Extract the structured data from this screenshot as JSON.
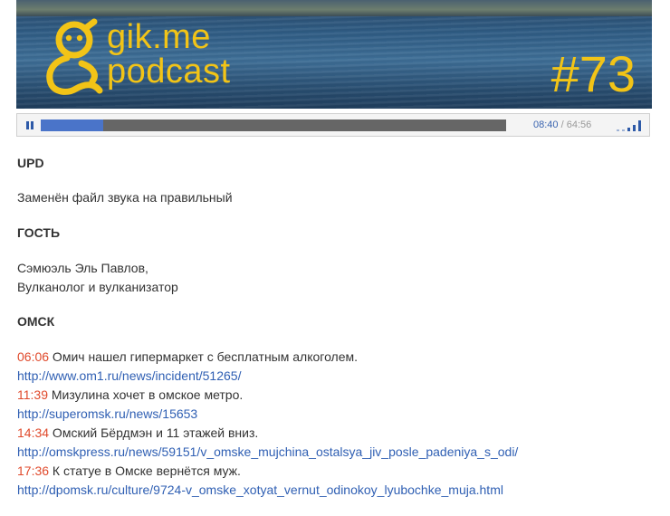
{
  "banner": {
    "brand_line1": "gik.me",
    "brand_line2": "podcast",
    "episode": "#73",
    "logo_icon": "gikme-mascot-icon"
  },
  "player": {
    "pause_icon": "pause-icon",
    "progress_fraction": 0.135,
    "current_time": "08:40",
    "separator": " / ",
    "total_time": "64:56",
    "volume_icon": "volume-bars-icon"
  },
  "sections": {
    "upd": {
      "heading": "UPD",
      "text": "Заменён файл звука на правильный"
    },
    "guest": {
      "heading": "ГОСТЬ",
      "line1": "Сэмюэль Эль Павлов,",
      "line2": "Вулканолог и вулканизатор"
    },
    "omsk": {
      "heading": "ОМСК",
      "items": [
        {
          "time": "06:06",
          "text": " Омич нашел гипермаркет с бесплатным алкоголем.",
          "url": "http://www.om1.ru/news/incident/51265/"
        },
        {
          "time": "11:39",
          "text": " Мизулина хочет в омское метро.",
          "url": "http://superomsk.ru/news/15653"
        },
        {
          "time": "14:34",
          "text": " Омский Бёрдмэн и 11 этажей вниз.",
          "url": "http://omskpress.ru/news/59151/v_omske_mujchina_ostalsya_jiv_posle_padeniya_s_odi/"
        },
        {
          "time": "17:36",
          "text": " К статуе в Омске вернётся муж.",
          "url": "http://dpomsk.ru/culture/9724-v_omske_xotyat_vernut_odinokoy_lyubochke_muja.html"
        }
      ]
    }
  },
  "colors": {
    "brand_yellow": "#f2c417",
    "timestamp_red": "#e04a2c",
    "link_blue": "#2f5fb3"
  }
}
